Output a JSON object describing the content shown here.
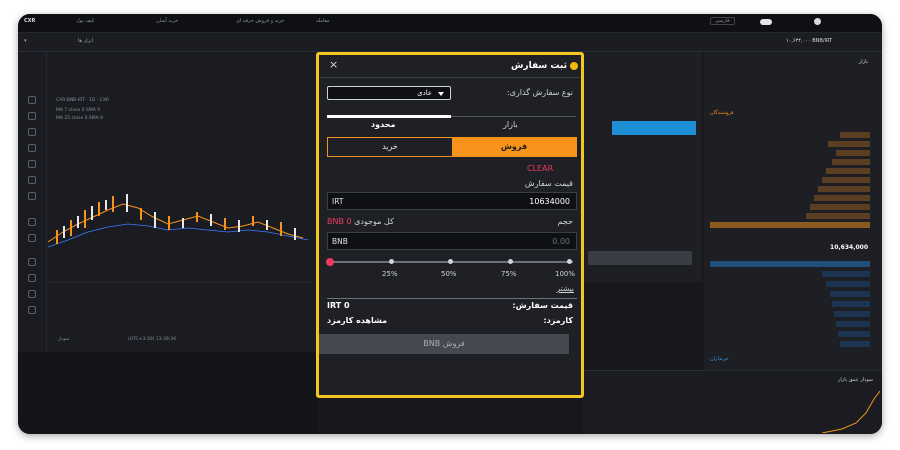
{
  "topbar": {
    "logo": "CXR",
    "items": [
      "کیف پول",
      "خرید آسان",
      "خرید و فروش حرفه ای",
      "معامله"
    ],
    "language": "فارسی"
  },
  "subbar": {
    "pair_select": "ابزار ها",
    "price_info": "۱۰,۶۳۴,۰۰۰ BNB/IRT"
  },
  "chart": {
    "symbol_line": "CXR:BNB-IRT · 1D · CXR",
    "ma1": "MA 7 close 0 SMA 9",
    "ma2": "MA 25 close 0 SMA 9",
    "bottom_label": "نمودار",
    "time_label": "(UTC+3:30) 13:39:34"
  },
  "orderbook": {
    "title": "بازار",
    "total_price": "10,634,000",
    "sell_label": "فروشندگان",
    "buy_label": "خریداران"
  },
  "bottom_panel": {
    "title": "نمودار عمق بازار"
  },
  "modal": {
    "title": "ثبت سفارش",
    "close": "×",
    "order_type_label": "نوع سفارش گذاری:",
    "order_type_value": "عادی",
    "tabs": [
      "محدود",
      "بازار"
    ],
    "buy_label": "خرید",
    "sell_label": "فروش",
    "clear_label": "CLEAR",
    "price_label": "قیمت سفارش",
    "price_currency": "IRT",
    "price_value": "10634000",
    "volume_label": "حجم",
    "balance_label": "کل موجودی",
    "balance_value": "BNB 0",
    "volume_currency": "BNB",
    "volume_placeholder": "0.00",
    "slider_percent": 0,
    "slider_ticks": [
      "25%",
      "50%",
      "75%",
      "100%"
    ],
    "more_label": "بیشتر",
    "order_price_label": "قیمت سفارش:",
    "order_price_value": "IRT 0",
    "fee_label": "کارمزد:",
    "fee_value": "مشاهده کارمزد",
    "submit_label": "فروش BNB"
  },
  "colors": {
    "highlight_border": "#f2c81e",
    "sell_accent": "#f7931a",
    "red_accent": "#ee3a5c"
  }
}
